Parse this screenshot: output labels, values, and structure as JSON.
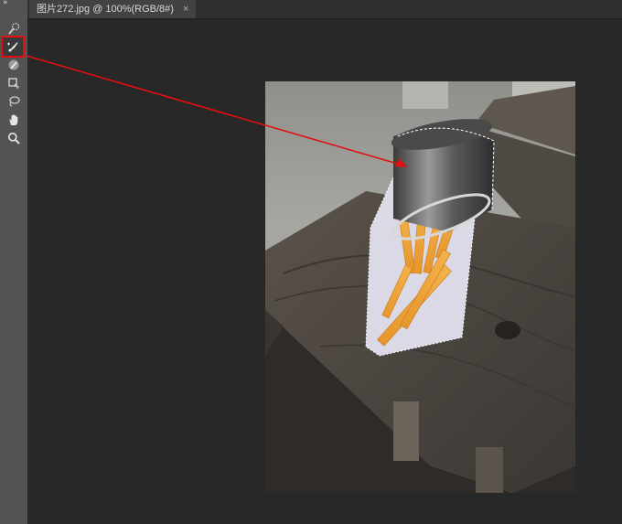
{
  "document_tab": {
    "title": "图片272.jpg @ 100%(RGB/8#)",
    "close_glyph": "×"
  },
  "toolbar": {
    "collapse_glyph": "»",
    "tools": [
      {
        "name": "quick-selection-tool-icon",
        "selected": false
      },
      {
        "name": "quick-selection-add-tool-icon",
        "selected": true
      },
      {
        "name": "quick-selection-subtract-tool-icon",
        "selected": false
      },
      {
        "name": "crop-tool-icon",
        "selected": false
      },
      {
        "name": "lasso-tool-icon",
        "selected": false
      },
      {
        "name": "hand-tool-icon",
        "selected": false
      },
      {
        "name": "zoom-tool-icon",
        "selected": false
      }
    ]
  },
  "colors": {
    "annotation": "#e01010",
    "toolbar_bg": "#535353",
    "workspace_bg": "#282828"
  }
}
